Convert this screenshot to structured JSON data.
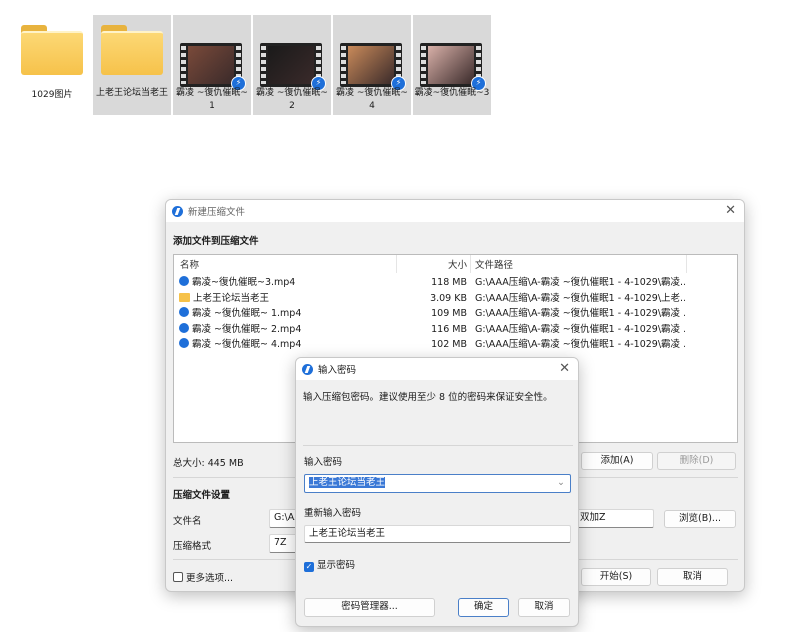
{
  "desktop": {
    "items": [
      {
        "label": "1029图片",
        "type": "folder",
        "selected": false
      },
      {
        "label": "上老王论坛当老王",
        "type": "folder",
        "selected": true
      },
      {
        "label": "霸凌 ~復仇催眠~ 1",
        "type": "video",
        "selected": true,
        "color": "#7a4a3a"
      },
      {
        "label": "霸凌 ~復仇催眠~ 2",
        "type": "video",
        "selected": true,
        "color": "#1a1a1a"
      },
      {
        "label": "霸凌 ~復仇催眠~ 4",
        "type": "video",
        "selected": true,
        "color": "#c98a5a"
      },
      {
        "label": "霸凌~復仇催眠~3",
        "type": "video",
        "selected": true,
        "color": "#d8b0a8"
      }
    ]
  },
  "main_dialog": {
    "title": "新建压缩文件",
    "section_title": "添加文件到压缩文件",
    "columns": [
      "名称",
      "大小",
      "文件路径"
    ],
    "files": [
      {
        "name": "霸凌~復仇催眠~3.mp4",
        "size": "118 MB",
        "path": "G:\\AAA压缩\\A-霸凌 ~復仇催眠1 - 4-1029\\霸凌...",
        "icon": "video"
      },
      {
        "name": "上老王论坛当老王",
        "size": "3.09 KB",
        "path": "G:\\AAA压缩\\A-霸凌 ~復仇催眠1 - 4-1029\\上老...",
        "icon": "folder"
      },
      {
        "name": "霸凌 ~復仇催眠~ 1.mp4",
        "size": "109 MB",
        "path": "G:\\AAA压缩\\A-霸凌 ~復仇催眠1 - 4-1029\\霸凌 ...",
        "icon": "video"
      },
      {
        "name": "霸凌 ~復仇催眠~ 2.mp4",
        "size": "116 MB",
        "path": "G:\\AAA压缩\\A-霸凌 ~復仇催眠1 - 4-1029\\霸凌 ...",
        "icon": "video"
      },
      {
        "name": "霸凌 ~復仇催眠~ 4.mp4",
        "size": "102 MB",
        "path": "G:\\AAA压缩\\A-霸凌 ~復仇催眠1 - 4-1029\\霸凌 ...",
        "icon": "video"
      }
    ],
    "total_size": "总大小: 445 MB",
    "add": "添加(A)",
    "delete": "删除(D)",
    "settings_title": "压缩文件设置",
    "filename_label": "文件名",
    "filename_value": "G:\\AA",
    "filename_tail": "双加Z",
    "browse": "浏览(B)...",
    "format_label": "压缩格式",
    "format_value": "7Z",
    "more_options": "更多选项...",
    "start": "开始(S)",
    "cancel": "取消"
  },
  "password_dialog": {
    "title": "输入密码",
    "description": "输入压缩包密码。建议使用至少 8 位的密码来保证安全性。",
    "password_label": "输入密码",
    "password_value": "上老王论坛当老王",
    "reenter_label": "重新输入密码",
    "reenter_value": "上老王论坛当老王",
    "show_password": "显示密码",
    "show_password_checked": true,
    "manager": "密码管理器...",
    "ok": "确定",
    "cancel": "取消"
  }
}
